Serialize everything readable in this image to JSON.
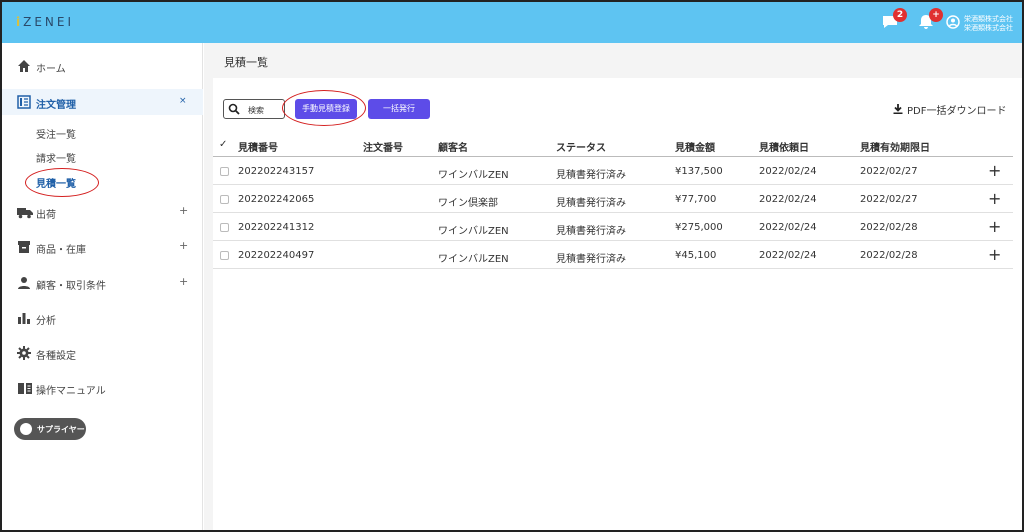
{
  "app": {
    "logo": "ZENEI",
    "notifications": {
      "messages_count": "2",
      "alerts_count": "+"
    },
    "company_line1": "栄酒類株式会社",
    "company_line2": "栄酒類株式会社"
  },
  "sidebar": {
    "items": [
      {
        "label": "ホーム",
        "icon": "home-icon"
      },
      {
        "label": "注文管理",
        "icon": "order-icon",
        "toggle": "×"
      },
      {
        "label": "出荷",
        "icon": "truck-icon",
        "toggle": "+"
      },
      {
        "label": "商品・在庫",
        "icon": "inventory-icon",
        "toggle": "+"
      },
      {
        "label": "顧客・取引条件",
        "icon": "person-icon",
        "toggle": "+"
      },
      {
        "label": "分析",
        "icon": "chart-icon"
      },
      {
        "label": "各種設定",
        "icon": "gear-icon"
      },
      {
        "label": "操作マニュアル",
        "icon": "book-icon"
      }
    ],
    "subitems": [
      "受注一覧",
      "請求一覧",
      "見積一覧"
    ],
    "supplier_label": "サプライヤー"
  },
  "main": {
    "title": "見積一覧",
    "search_label": "検索",
    "manual_register_button": "手動見積登録",
    "batch_issue_button": "一括発行",
    "pdf_download": "PDF一括ダウンロード",
    "columns": [
      "✓",
      "見積番号",
      "注文番号",
      "顧客名",
      "ステータス",
      "見積金額",
      "見積依頼日",
      "見積有効期限日"
    ],
    "rows": [
      {
        "quote_no": "202202243157",
        "order_no": "",
        "customer": "ワインバルZEN",
        "status": "見積書発行済み",
        "amount": "¥137,500",
        "request_date": "2022/02/24",
        "expiry_date": "2022/02/27"
      },
      {
        "quote_no": "202202242065",
        "order_no": "",
        "customer": "ワイン倶楽部",
        "status": "見積書発行済み",
        "amount": "¥77,700",
        "request_date": "2022/02/24",
        "expiry_date": "2022/02/27"
      },
      {
        "quote_no": "202202241312",
        "order_no": "",
        "customer": "ワインバルZEN",
        "status": "見積書発行済み",
        "amount": "¥275,000",
        "request_date": "2022/02/24",
        "expiry_date": "2022/02/28"
      },
      {
        "quote_no": "202202240497",
        "order_no": "",
        "customer": "ワインバルZEN",
        "status": "見積書発行済み",
        "amount": "¥45,100",
        "request_date": "2022/02/24",
        "expiry_date": "2022/02/28"
      }
    ],
    "expand_symbol": "+"
  },
  "colors": {
    "topbar": "#5ec4f2",
    "accent": "#5d4ce8",
    "active_nav": "#2060a8",
    "annotation_ring": "#d42020"
  }
}
